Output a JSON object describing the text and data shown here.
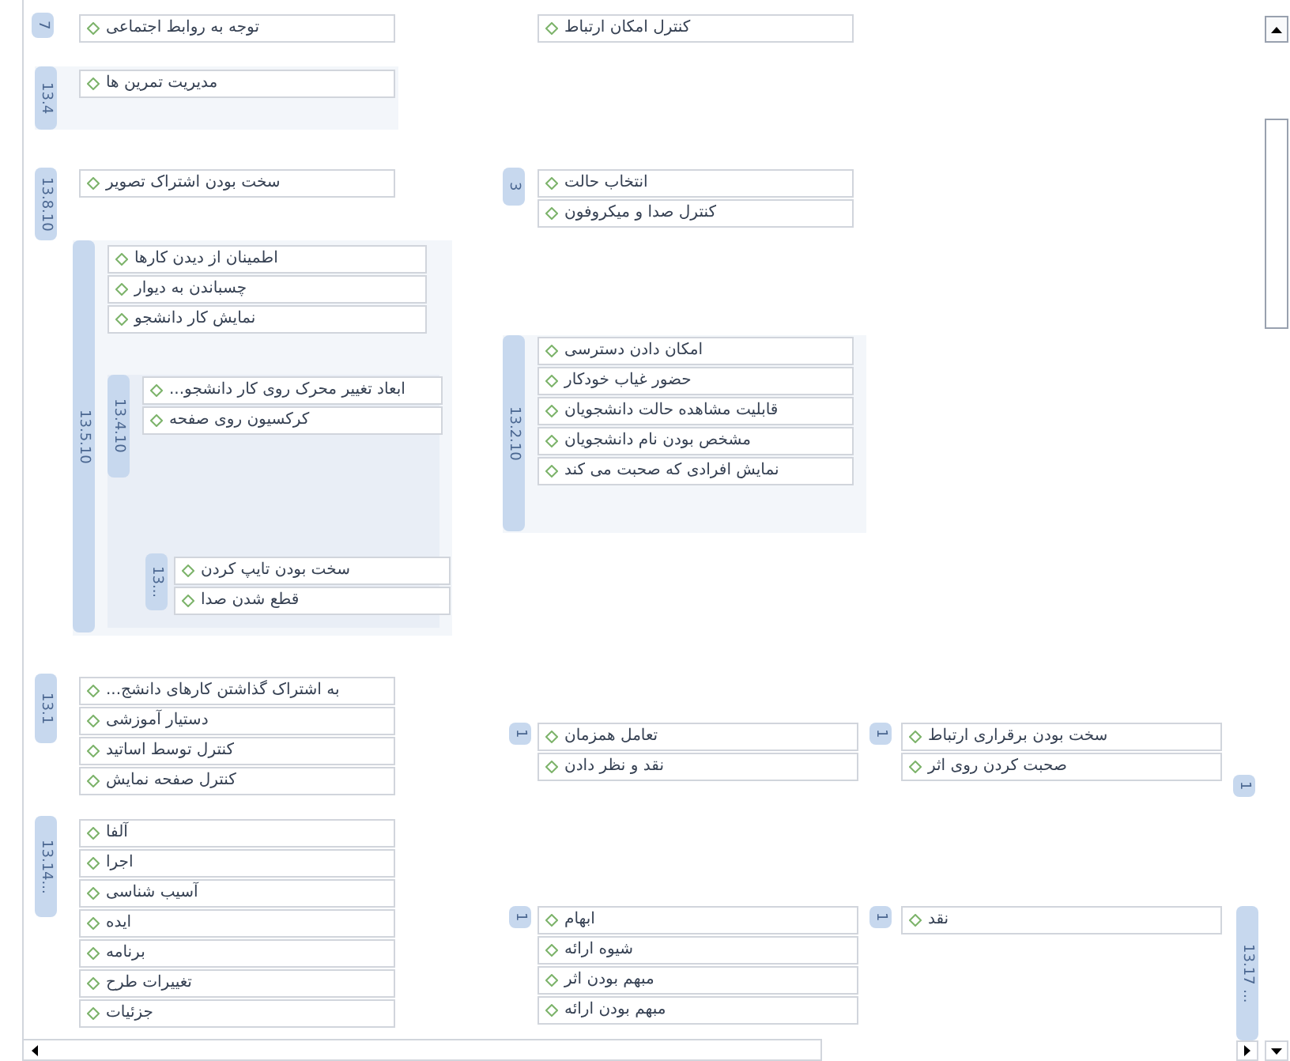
{
  "groups": [
    {
      "label": "7",
      "items": [
        "توجه به روابط اجتماعی"
      ]
    },
    {
      "label": "13.4",
      "items": [
        "مدیریت تمرین ها"
      ]
    },
    {
      "label": "13.8.10",
      "items": [
        "سخت بودن اشتراک تصویر"
      ]
    },
    {
      "label": "13.5.10",
      "items": [
        "اطمینان از دیدن کارها",
        "چسباندن به دیوار",
        "نمایش کار دانشجو"
      ]
    },
    {
      "label": "13.4.10",
      "items": [
        "ابعاد تغییر محرک روی کار دانشجو...",
        "کرکسیون روی صفحه"
      ]
    },
    {
      "label": "13...",
      "items": [
        "سخت بودن تایپ کردن",
        "قطع شدن صدا"
      ]
    },
    {
      "items": [
        "کنترل امکان ارتباط"
      ]
    },
    {
      "label": "3",
      "items": [
        "انتخاب حالت",
        "کنترل صدا و میکروفون"
      ]
    },
    {
      "label": "13.2.10",
      "items": [
        "امکان دادن دسترسی",
        "حضور غیاب خودکار",
        "قابلیت مشاهده حالت دانشجویان",
        "مشخص بودن نام دانشجویان",
        "نمایش افرادی که صحبت می کند"
      ]
    },
    {
      "label": "13.1",
      "items": [
        "به اشتراک گذاشتن کارهای دانشج...",
        "دستیار آموزشی",
        "کنترل توسط اساتید",
        "کنترل صفحه نمایش"
      ]
    },
    {
      "label": "13.14...",
      "items": [
        "آلفا",
        "اجرا",
        "آسیب شناسی",
        "ایده",
        "برنامه",
        "تغییرات طرح",
        "جزئیات"
      ]
    },
    {
      "label": "1",
      "items": [
        "تعامل همزمان",
        "نقد و نظر دادن"
      ]
    },
    {
      "label": "1",
      "items": [
        "سخت بودن برقراری ارتباط",
        "صحبت کردن روی اثر"
      ]
    },
    {
      "label": "1"
    },
    {
      "label": "1",
      "items": [
        "ابهام",
        "شیوه ارائه",
        "مبهم بودن اثر",
        "مبهم بودن ارائه"
      ]
    },
    {
      "label": "1",
      "items": [
        "نقد"
      ]
    },
    {
      "label": "13.17 ..."
    }
  ]
}
